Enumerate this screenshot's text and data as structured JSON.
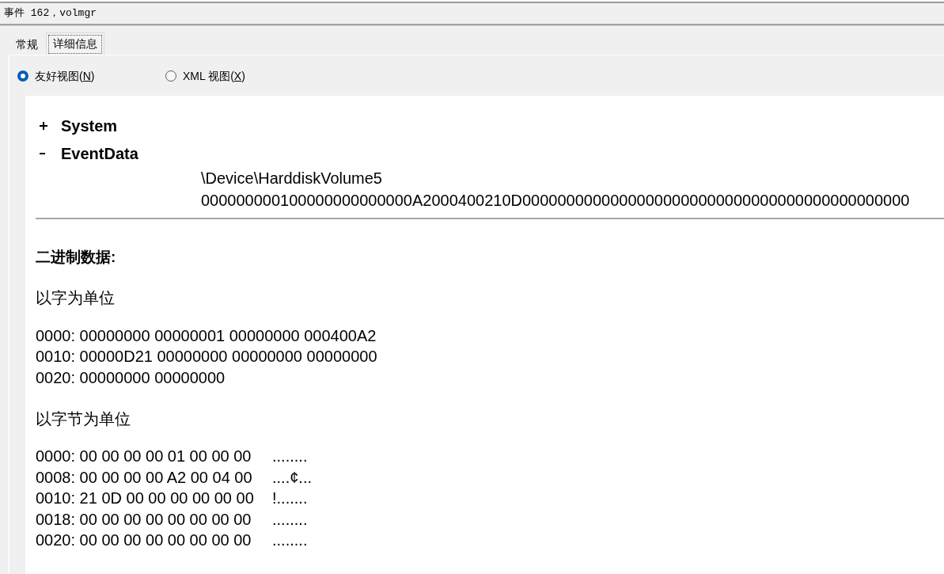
{
  "window": {
    "title": "事件 162，volmgr"
  },
  "tabs": [
    {
      "label": "常规",
      "selected": false
    },
    {
      "label": "详细信息",
      "selected": true
    }
  ],
  "views": [
    {
      "label": "友好视图(",
      "access_key": "N",
      "label_end": ")",
      "selected": true
    },
    {
      "label": "XML 视图(",
      "access_key": "X",
      "label_end": ")",
      "selected": false
    }
  ],
  "details": {
    "nodes": [
      {
        "label": "System",
        "expanded": false
      },
      {
        "label": "EventData",
        "expanded": true,
        "values": [
          "\\Device\\HarddiskVolume5",
          "000000000100000000000000A2000400210D00000000000000000000000000000000000000000000"
        ]
      }
    ],
    "binary": {
      "heading": "二进制数据:",
      "sections": [
        {
          "kind": "words",
          "title": "以字为单位",
          "rows": [
            "0000: 00000000 00000001 00000000 000400A2",
            "0010: 00000D21 00000000 00000000 00000000",
            "0020: 00000000 00000000"
          ]
        },
        {
          "kind": "bytes",
          "title": "以字节为单位",
          "rows": [
            {
              "hex": "0000: 00 00 00 00 01 00 00 00",
              "ascii": "........"
            },
            {
              "hex": "0008: 00 00 00 00 A2 00 04 00",
              "ascii": "....¢..."
            },
            {
              "hex": "0010: 21 0D 00 00 00 00 00 00",
              "ascii": "!......."
            },
            {
              "hex": "0018: 00 00 00 00 00 00 00 00",
              "ascii": "........"
            },
            {
              "hex": "0020: 00 00 00 00 00 00 00 00",
              "ascii": "........"
            }
          ]
        }
      ]
    }
  }
}
